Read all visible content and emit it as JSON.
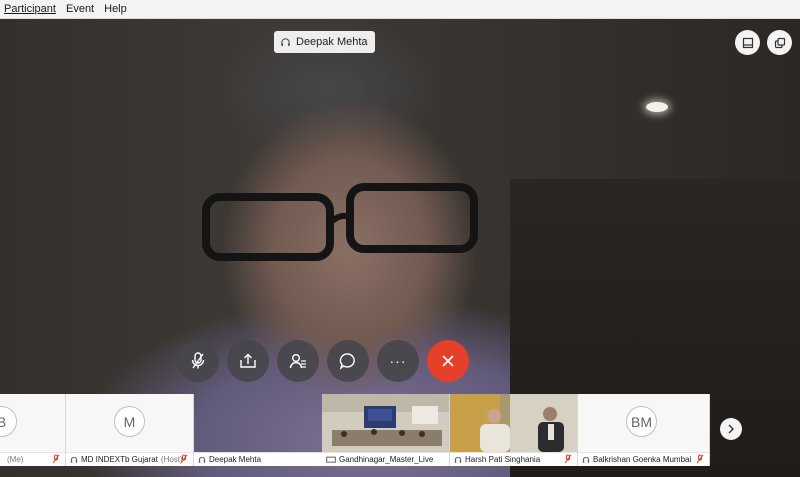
{
  "menu": {
    "items": [
      "Participant",
      "Event",
      "Help"
    ]
  },
  "speaker": {
    "name": "Deepak Mehta"
  },
  "top_controls": {
    "layout_icon": "layout-icon",
    "popout_icon": "popout-icon"
  },
  "controls": {
    "mute_icon": "mic-off-icon",
    "share_icon": "share-icon",
    "participants_icon": "participants-icon",
    "chat_icon": "chat-icon",
    "more_label": "···",
    "end_icon": "close-icon"
  },
  "strip": {
    "tiles": [
      {
        "initials": "B",
        "name": "",
        "suffix": "(Me)"
      },
      {
        "initials": "M",
        "name": "MD INDEXTb Gujarat",
        "suffix": "(Host)"
      },
      {
        "name": "Deepak Mehta",
        "suffix": ""
      },
      {
        "name": "Gandhinagar_Master_Live",
        "suffix": ""
      },
      {
        "name": "Harsh Pati Singhania",
        "suffix": ""
      },
      {
        "initials": "BM",
        "name": "Balkrishan Goenka Mumbai",
        "suffix": ""
      }
    ]
  },
  "colors": {
    "end_call": "#e4402a",
    "mic_off": "#d83a2a"
  }
}
